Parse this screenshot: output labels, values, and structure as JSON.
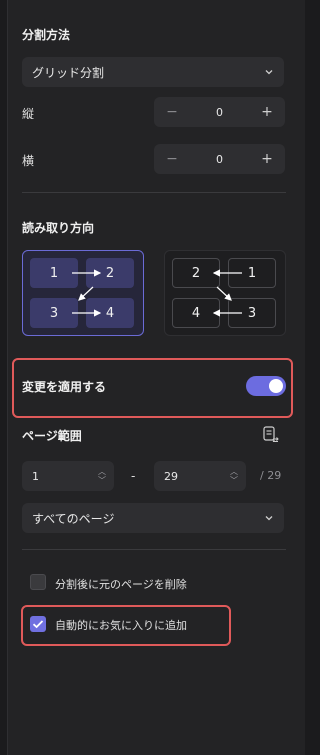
{
  "split": {
    "title": "分割方法",
    "method_value": "グリッド分割",
    "vertical_label": "縦",
    "vertical_value": "0",
    "horizontal_label": "横",
    "horizontal_value": "0",
    "minus": "−",
    "plus": "+"
  },
  "reading_order": {
    "title": "読み取り方向",
    "left_to_right": [
      "1",
      "2",
      "3",
      "4"
    ],
    "right_to_left": [
      "2",
      "1",
      "4",
      "3"
    ],
    "selected": "left_to_right"
  },
  "apply_changes": {
    "label": "変更を適用する",
    "enabled": true
  },
  "page_range": {
    "title": "ページ範囲",
    "from": "1",
    "separator": "-",
    "to": "29",
    "total": "/ 29",
    "scope_value": "すべてのページ"
  },
  "options": {
    "delete_original_label": "分割後に元のページを削除",
    "delete_original_checked": false,
    "add_favorites_label": "自動的にお気に入りに追加",
    "add_favorites_checked": true
  },
  "colors": {
    "accent": "#6c6ce0",
    "highlight": "#e05a5a",
    "panel_bg": "#232325"
  }
}
